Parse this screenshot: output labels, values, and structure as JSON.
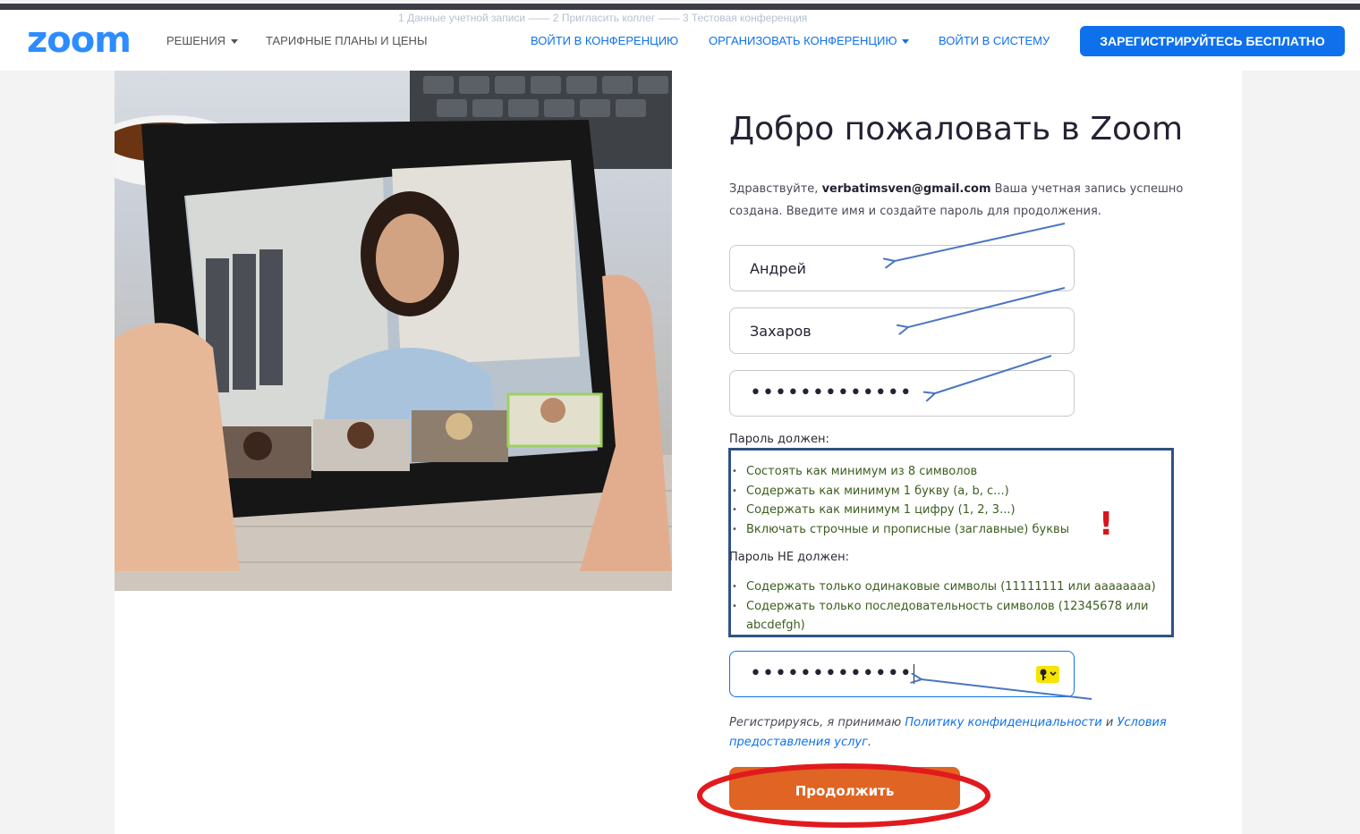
{
  "header": {
    "logo": "zoom",
    "nav_solutions": "РЕШЕНИЯ",
    "nav_plans": "ТАРИФНЫЕ ПЛАНЫ И ЦЕНЫ",
    "nav_join": "ВОЙТИ В КОНФЕРЕНЦИЮ",
    "nav_host": "ОРГАНИЗОВАТЬ КОНФЕРЕНЦИЮ",
    "nav_signin": "ВОЙТИ В СИСТЕМУ",
    "signup_button": "ЗАРЕГИСТРИРУЙТЕСЬ БЕСПЛАТНО",
    "steps_faded": "1  Данные учетной записи ——  2  Пригласить коллег ——  3  Тестовая конференция"
  },
  "form": {
    "title": "Добро пожаловать в Zoom",
    "greeting": "Здравствуйте,",
    "email": "verbatimsven@gmail.com",
    "greeting_rest": "Ваша учетная запись успешно создана. Введите имя и создайте пароль для продолжения.",
    "first_name": "Андрей",
    "last_name": "Захаров",
    "password_masked": "•••••••••••••",
    "confirm_masked": "•••••••••••••",
    "requirements_title": "Пароль должен:",
    "requirements": [
      "Состоять как минимум из 8 символов",
      "Содержать как минимум 1 букву (a, b, c...)",
      "Содержать как минимум 1 цифру (1, 2, 3...)",
      "Включать строчные и прописные (заглавные) буквы"
    ],
    "prohibitions_title": "Пароль НЕ должен:",
    "prohibitions": [
      "Содержать только одинаковые символы (11111111 или ааааааaa)",
      "Содержать только последовательность символов (12345678 или abcdefgh)"
    ],
    "exclamation": "!",
    "terms_prefix": "Регистрируясь, я принимаю",
    "terms_privacy": "Политику конфиденциальности",
    "terms_and": "и",
    "terms_service": "Условия предоставления услуг",
    "terms_end": ".",
    "continue_button": "Продолжить"
  },
  "icons": {
    "password_manager": "key-icon"
  },
  "colors": {
    "brand_blue": "#2d8cff",
    "link_blue": "#0e71eb",
    "continue_orange": "#e06423",
    "annotation_arrow": "#4a76c2",
    "annotation_box": "#2f5283",
    "annotation_red": "#e11a1f"
  }
}
